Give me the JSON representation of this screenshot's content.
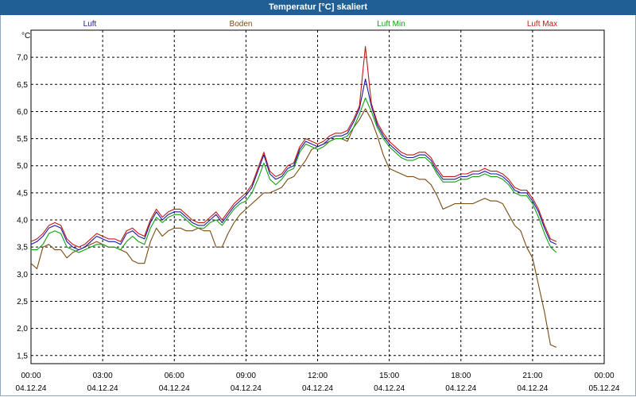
{
  "window": {
    "title": "Temperatur [°C] skaliert"
  },
  "chart_data": {
    "type": "line",
    "title": "Temperatur [°C] skaliert",
    "ylabel": "°C",
    "ylim": [
      1.35,
      7.5
    ],
    "yticks": [
      "1,5",
      "2,0",
      "2,5",
      "3,0",
      "3,5",
      "4,0",
      "4,5",
      "5,0",
      "5,5",
      "6,0",
      "6,5",
      "7,0"
    ],
    "ytick_values": [
      1.5,
      2.0,
      2.5,
      3.0,
      3.5,
      4.0,
      4.5,
      5.0,
      5.5,
      6.0,
      6.5,
      7.0
    ],
    "xlim_hours": [
      0,
      24
    ],
    "xticks": [
      {
        "h": 0,
        "time": "00:00",
        "date": "04.12.24"
      },
      {
        "h": 3,
        "time": "03:00",
        "date": "04.12.24"
      },
      {
        "h": 6,
        "time": "06:00",
        "date": "04.12.24"
      },
      {
        "h": 9,
        "time": "09:00",
        "date": "04.12.24"
      },
      {
        "h": 12,
        "time": "12:00",
        "date": "04.12.24"
      },
      {
        "h": 15,
        "time": "15:00",
        "date": "04.12.24"
      },
      {
        "h": 18,
        "time": "18:00",
        "date": "04.12.24"
      },
      {
        "h": 21,
        "time": "21:00",
        "date": "04.12.24"
      },
      {
        "h": 24,
        "time": "00:00",
        "date": "05.12.24"
      }
    ],
    "grid": true,
    "x": [
      0,
      0.25,
      0.5,
      0.75,
      1,
      1.25,
      1.5,
      1.75,
      2,
      2.25,
      2.5,
      2.75,
      3,
      3.25,
      3.5,
      3.75,
      4,
      4.25,
      4.5,
      4.75,
      5,
      5.25,
      5.5,
      5.75,
      6,
      6.25,
      6.5,
      6.75,
      7,
      7.25,
      7.5,
      7.75,
      8,
      8.25,
      8.5,
      8.75,
      9,
      9.25,
      9.5,
      9.75,
      10,
      10.25,
      10.5,
      10.75,
      11,
      11.25,
      11.5,
      11.75,
      12,
      12.25,
      12.5,
      12.75,
      13,
      13.25,
      13.5,
      13.75,
      14,
      14.25,
      14.5,
      14.75,
      15,
      15.25,
      15.5,
      15.75,
      16,
      16.25,
      16.5,
      16.75,
      17,
      17.25,
      17.5,
      17.75,
      18,
      18.25,
      18.5,
      18.75,
      19,
      19.25,
      19.5,
      19.75,
      20,
      20.25,
      20.5,
      20.75,
      21,
      21.25,
      21.5,
      21.75,
      22,
      22.25,
      22.5,
      22.75,
      23,
      23.25,
      23.5,
      23.75,
      24
    ],
    "series": [
      {
        "name": "Luft",
        "color": "#1a1aa0",
        "values": [
          3.55,
          3.6,
          3.7,
          3.85,
          3.9,
          3.85,
          3.6,
          3.5,
          3.45,
          3.5,
          3.6,
          3.7,
          3.65,
          3.6,
          3.6,
          3.55,
          3.75,
          3.8,
          3.7,
          3.65,
          3.95,
          4.15,
          4.0,
          4.1,
          4.15,
          4.15,
          4.05,
          3.95,
          3.9,
          3.9,
          4.0,
          4.1,
          3.95,
          4.1,
          4.25,
          4.35,
          4.45,
          4.6,
          4.9,
          5.2,
          4.85,
          4.75,
          4.8,
          4.95,
          5.0,
          5.3,
          5.45,
          5.4,
          5.35,
          5.4,
          5.5,
          5.55,
          5.55,
          5.6,
          5.8,
          6.05,
          6.6,
          6.1,
          5.75,
          5.55,
          5.4,
          5.3,
          5.2,
          5.15,
          5.15,
          5.2,
          5.2,
          5.1,
          4.9,
          4.75,
          4.75,
          4.75,
          4.8,
          4.8,
          4.85,
          4.85,
          4.9,
          4.85,
          4.85,
          4.8,
          4.7,
          4.55,
          4.5,
          4.5,
          4.35,
          4.15,
          3.85,
          3.6,
          3.55
        ]
      },
      {
        "name": "Boden",
        "color": "#7a4a10",
        "values": [
          3.2,
          3.1,
          3.5,
          3.55,
          3.45,
          3.45,
          3.3,
          3.4,
          3.45,
          3.5,
          3.55,
          3.6,
          3.55,
          3.5,
          3.5,
          3.45,
          3.4,
          3.25,
          3.2,
          3.2,
          3.6,
          3.85,
          3.7,
          3.8,
          3.85,
          3.85,
          3.8,
          3.8,
          3.85,
          3.8,
          3.8,
          3.5,
          3.5,
          3.75,
          3.95,
          4.1,
          4.2,
          4.3,
          4.4,
          4.5,
          4.5,
          4.55,
          4.6,
          4.75,
          4.8,
          4.95,
          5.1,
          5.3,
          5.35,
          5.4,
          5.45,
          5.5,
          5.5,
          5.45,
          5.7,
          5.85,
          6.05,
          5.85,
          5.55,
          5.2,
          4.95,
          4.9,
          4.85,
          4.8,
          4.8,
          4.75,
          4.75,
          4.65,
          4.45,
          4.2,
          4.25,
          4.3,
          4.3,
          4.3,
          4.3,
          4.35,
          4.4,
          4.35,
          4.35,
          4.3,
          4.1,
          3.9,
          3.8,
          3.5,
          3.3,
          2.8,
          2.3,
          1.7,
          1.65
        ]
      },
      {
        "name": "Luft Min",
        "color": "#10a010",
        "values": [
          3.45,
          3.45,
          3.55,
          3.75,
          3.8,
          3.75,
          3.5,
          3.45,
          3.4,
          3.45,
          3.5,
          3.55,
          3.55,
          3.5,
          3.5,
          3.45,
          3.6,
          3.7,
          3.6,
          3.55,
          3.85,
          4.05,
          3.95,
          4.05,
          4.1,
          4.1,
          4.0,
          3.9,
          3.85,
          3.85,
          3.95,
          4.0,
          3.9,
          4.05,
          4.2,
          4.3,
          4.35,
          4.5,
          4.75,
          5.05,
          4.75,
          4.65,
          4.75,
          4.9,
          4.95,
          5.25,
          5.4,
          5.35,
          5.3,
          5.35,
          5.45,
          5.5,
          5.5,
          5.55,
          5.7,
          5.95,
          6.25,
          6.0,
          5.7,
          5.5,
          5.35,
          5.25,
          5.15,
          5.1,
          5.1,
          5.15,
          5.15,
          5.05,
          4.85,
          4.7,
          4.7,
          4.7,
          4.75,
          4.75,
          4.8,
          4.8,
          4.85,
          4.8,
          4.8,
          4.75,
          4.65,
          4.5,
          4.45,
          4.45,
          4.3,
          4.05,
          3.75,
          3.5,
          3.4
        ]
      },
      {
        "name": "Luft Max",
        "color": "#c01818",
        "values": [
          3.6,
          3.65,
          3.75,
          3.9,
          3.95,
          3.9,
          3.65,
          3.55,
          3.5,
          3.55,
          3.65,
          3.75,
          3.7,
          3.65,
          3.65,
          3.6,
          3.8,
          3.85,
          3.75,
          3.7,
          4.0,
          4.2,
          4.05,
          4.15,
          4.2,
          4.2,
          4.1,
          4.0,
          3.95,
          3.95,
          4.05,
          4.15,
          4.0,
          4.15,
          4.3,
          4.4,
          4.5,
          4.65,
          4.95,
          5.25,
          4.9,
          4.8,
          4.85,
          5.0,
          5.05,
          5.35,
          5.5,
          5.45,
          5.4,
          5.45,
          5.55,
          5.6,
          5.6,
          5.65,
          5.85,
          6.1,
          7.2,
          6.15,
          5.8,
          5.6,
          5.45,
          5.35,
          5.25,
          5.2,
          5.2,
          5.25,
          5.25,
          5.15,
          4.95,
          4.8,
          4.8,
          4.8,
          4.85,
          4.85,
          4.9,
          4.9,
          4.95,
          4.9,
          4.9,
          4.85,
          4.75,
          4.6,
          4.55,
          4.55,
          4.4,
          4.2,
          3.9,
          3.65,
          3.6
        ]
      }
    ]
  }
}
